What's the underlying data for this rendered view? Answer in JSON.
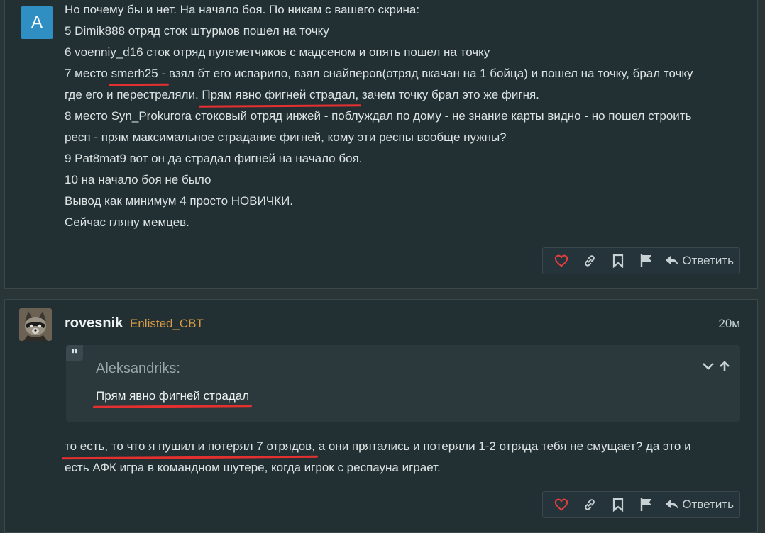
{
  "post1": {
    "avatar_letter": "A",
    "lines": [
      "Но почему бы и нет. На начало боя. По никам с вашего скрина:",
      "5 Dimik888 отряд сток штурмов пошел на точку",
      "6 voenniy_d16 сток отряд пулеметчиков с мадсеном и опять пошел на точку"
    ],
    "line7": {
      "pre": "7 место ",
      "ul": "smerh25 -",
      "post": " взял бт его испарило, взял снайперов(отряд вкачан на 1 бойца) и пошел на точку, брал точку"
    },
    "line8": {
      "pre": "где его и перестреляли. ",
      "ul": "Прям явно фигней страдал,",
      "post": " зачем точку брал это же фигня."
    },
    "lines_tail": [
      "8 место Syn_Prokurora стоковый отряд инжей - поблуждал по дому - не знание карты видно - но пошел строить",
      "респ - прям максимальное страдание фигней, кому эти респы вообще нужны?",
      "9 Pat8mat9 вот он да страдал фигней на начало боя.",
      "10 на начало боя не было",
      "Вывод как минимум 4 просто НОВИЧКИ.",
      "Сейчас гляну мемцев."
    ],
    "reply_label": "Ответить"
  },
  "post2": {
    "username": "rovesnik",
    "usertag": "Enlisted_CBT",
    "time": "20м",
    "quote": {
      "author": "Aleksandriks:",
      "text": "Прям явно фигней страдал"
    },
    "body_line1": {
      "ul": "то есть, то что я пушил и потерял 7 отрядов,",
      "post": " а они прятались и потеряли 1-2 отряда тебя не смущает? да это и"
    },
    "body_line2": "есть АФК игра в командном шутере, когда игрок с респауна играет.",
    "reply_label": "Ответить"
  },
  "colors": {
    "background": "#2a3538",
    "post_bg": "#223033",
    "avatar_blue": "#2f8fc3",
    "usertag": "#d79b44",
    "underline": "#e53030",
    "heart": "#e53e3e"
  },
  "icons": [
    "heart-icon",
    "link-icon",
    "bookmark-icon",
    "flag-icon",
    "reply-icon",
    "quote-icon",
    "chevron-down-icon",
    "arrow-up-icon"
  ]
}
